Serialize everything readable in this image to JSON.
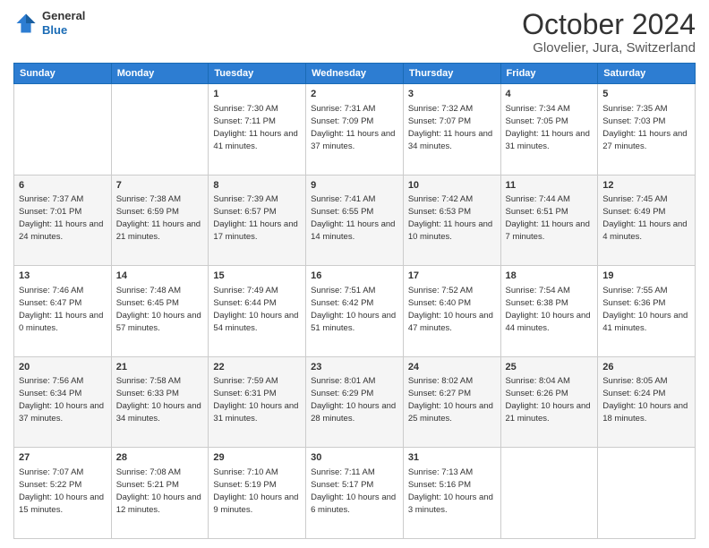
{
  "header": {
    "logo": {
      "general": "General",
      "blue": "Blue"
    },
    "title": "October 2024",
    "location": "Glovelier, Jura, Switzerland"
  },
  "weekdays": [
    "Sunday",
    "Monday",
    "Tuesday",
    "Wednesday",
    "Thursday",
    "Friday",
    "Saturday"
  ],
  "weeks": [
    [
      {
        "day": "",
        "info": ""
      },
      {
        "day": "",
        "info": ""
      },
      {
        "day": "1",
        "info": "Sunrise: 7:30 AM\nSunset: 7:11 PM\nDaylight: 11 hours and 41 minutes."
      },
      {
        "day": "2",
        "info": "Sunrise: 7:31 AM\nSunset: 7:09 PM\nDaylight: 11 hours and 37 minutes."
      },
      {
        "day": "3",
        "info": "Sunrise: 7:32 AM\nSunset: 7:07 PM\nDaylight: 11 hours and 34 minutes."
      },
      {
        "day": "4",
        "info": "Sunrise: 7:34 AM\nSunset: 7:05 PM\nDaylight: 11 hours and 31 minutes."
      },
      {
        "day": "5",
        "info": "Sunrise: 7:35 AM\nSunset: 7:03 PM\nDaylight: 11 hours and 27 minutes."
      }
    ],
    [
      {
        "day": "6",
        "info": "Sunrise: 7:37 AM\nSunset: 7:01 PM\nDaylight: 11 hours and 24 minutes."
      },
      {
        "day": "7",
        "info": "Sunrise: 7:38 AM\nSunset: 6:59 PM\nDaylight: 11 hours and 21 minutes."
      },
      {
        "day": "8",
        "info": "Sunrise: 7:39 AM\nSunset: 6:57 PM\nDaylight: 11 hours and 17 minutes."
      },
      {
        "day": "9",
        "info": "Sunrise: 7:41 AM\nSunset: 6:55 PM\nDaylight: 11 hours and 14 minutes."
      },
      {
        "day": "10",
        "info": "Sunrise: 7:42 AM\nSunset: 6:53 PM\nDaylight: 11 hours and 10 minutes."
      },
      {
        "day": "11",
        "info": "Sunrise: 7:44 AM\nSunset: 6:51 PM\nDaylight: 11 hours and 7 minutes."
      },
      {
        "day": "12",
        "info": "Sunrise: 7:45 AM\nSunset: 6:49 PM\nDaylight: 11 hours and 4 minutes."
      }
    ],
    [
      {
        "day": "13",
        "info": "Sunrise: 7:46 AM\nSunset: 6:47 PM\nDaylight: 11 hours and 0 minutes."
      },
      {
        "day": "14",
        "info": "Sunrise: 7:48 AM\nSunset: 6:45 PM\nDaylight: 10 hours and 57 minutes."
      },
      {
        "day": "15",
        "info": "Sunrise: 7:49 AM\nSunset: 6:44 PM\nDaylight: 10 hours and 54 minutes."
      },
      {
        "day": "16",
        "info": "Sunrise: 7:51 AM\nSunset: 6:42 PM\nDaylight: 10 hours and 51 minutes."
      },
      {
        "day": "17",
        "info": "Sunrise: 7:52 AM\nSunset: 6:40 PM\nDaylight: 10 hours and 47 minutes."
      },
      {
        "day": "18",
        "info": "Sunrise: 7:54 AM\nSunset: 6:38 PM\nDaylight: 10 hours and 44 minutes."
      },
      {
        "day": "19",
        "info": "Sunrise: 7:55 AM\nSunset: 6:36 PM\nDaylight: 10 hours and 41 minutes."
      }
    ],
    [
      {
        "day": "20",
        "info": "Sunrise: 7:56 AM\nSunset: 6:34 PM\nDaylight: 10 hours and 37 minutes."
      },
      {
        "day": "21",
        "info": "Sunrise: 7:58 AM\nSunset: 6:33 PM\nDaylight: 10 hours and 34 minutes."
      },
      {
        "day": "22",
        "info": "Sunrise: 7:59 AM\nSunset: 6:31 PM\nDaylight: 10 hours and 31 minutes."
      },
      {
        "day": "23",
        "info": "Sunrise: 8:01 AM\nSunset: 6:29 PM\nDaylight: 10 hours and 28 minutes."
      },
      {
        "day": "24",
        "info": "Sunrise: 8:02 AM\nSunset: 6:27 PM\nDaylight: 10 hours and 25 minutes."
      },
      {
        "day": "25",
        "info": "Sunrise: 8:04 AM\nSunset: 6:26 PM\nDaylight: 10 hours and 21 minutes."
      },
      {
        "day": "26",
        "info": "Sunrise: 8:05 AM\nSunset: 6:24 PM\nDaylight: 10 hours and 18 minutes."
      }
    ],
    [
      {
        "day": "27",
        "info": "Sunrise: 7:07 AM\nSunset: 5:22 PM\nDaylight: 10 hours and 15 minutes."
      },
      {
        "day": "28",
        "info": "Sunrise: 7:08 AM\nSunset: 5:21 PM\nDaylight: 10 hours and 12 minutes."
      },
      {
        "day": "29",
        "info": "Sunrise: 7:10 AM\nSunset: 5:19 PM\nDaylight: 10 hours and 9 minutes."
      },
      {
        "day": "30",
        "info": "Sunrise: 7:11 AM\nSunset: 5:17 PM\nDaylight: 10 hours and 6 minutes."
      },
      {
        "day": "31",
        "info": "Sunrise: 7:13 AM\nSunset: 5:16 PM\nDaylight: 10 hours and 3 minutes."
      },
      {
        "day": "",
        "info": ""
      },
      {
        "day": "",
        "info": ""
      }
    ]
  ]
}
